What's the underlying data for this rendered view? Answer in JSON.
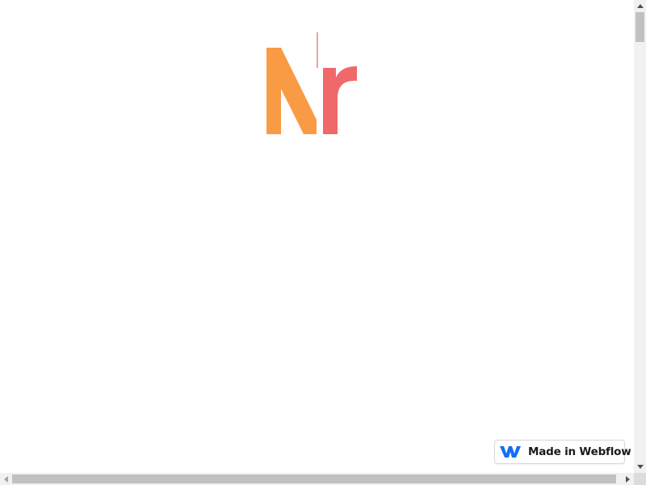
{
  "page": {
    "background": "#ffffff"
  },
  "logo": {
    "icon": "nr-logo-icon",
    "colors": {
      "orange": "#f99b45",
      "coral": "#f0686a",
      "line": "#f4a0a0"
    }
  },
  "badge": {
    "label": "Made in Webflow",
    "icon": "webflow-icon",
    "icon_color": "#146ef5"
  },
  "scrollbars": {
    "vertical": {
      "icon_up": "chevron-up-icon",
      "icon_down": "chevron-down-icon"
    },
    "horizontal": {
      "icon_left": "chevron-left-icon",
      "icon_right": "chevron-right-icon"
    }
  }
}
